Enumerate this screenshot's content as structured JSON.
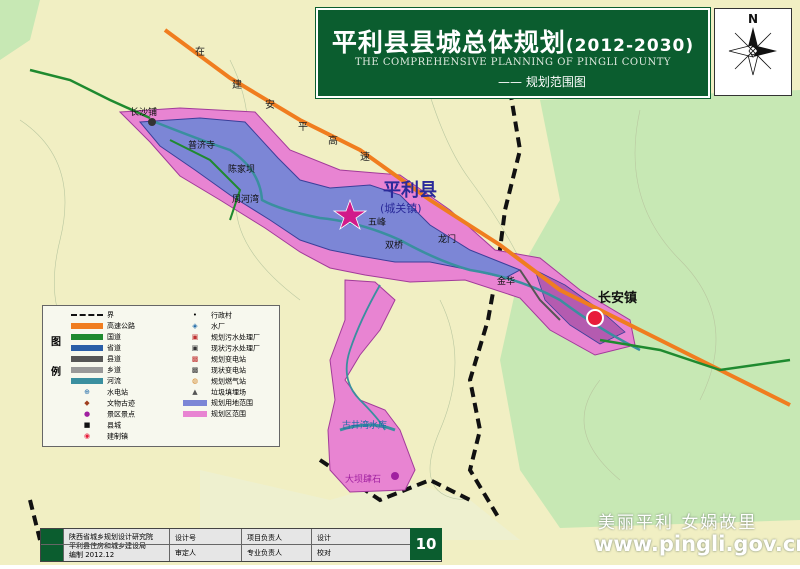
{
  "title": {
    "main": "平利县县城总体规划",
    "years": "(2012-2030)",
    "english": "THE COMPREHENSIVE PLANNING OF PINGLI COUNTY",
    "subtitle": "—— 规划范围图"
  },
  "north_label": "N",
  "map_labels": {
    "county": "平利县",
    "county_sub": "(城关镇)",
    "changan": "长安镇",
    "changsha": "长沙铺",
    "puji": "普济寺",
    "chenjiaba": "陈家坝",
    "zhouhezhen": "周河湾",
    "wufeng": "五峰",
    "shuangtiao": "双桥",
    "longmen": "龙门",
    "jinhua": "金华",
    "gujingwan": "古井湾水库",
    "dahu": "大坝肆石",
    "highway_chars": [
      "在",
      "建",
      "安",
      "平",
      "高",
      "速"
    ]
  },
  "legend": {
    "heading": "图例",
    "left": [
      "界",
      "高速公路",
      "国道",
      "省道",
      "县道",
      "乡道",
      "河流",
      "水电站",
      "文物古迹",
      "景区景点",
      "县城",
      "建制镇"
    ],
    "right": [
      "行政村",
      "水厂",
      "规划污水处理厂",
      "现状污水处理厂",
      "规划变电站",
      "现状变电站",
      "规划燃气站",
      "垃圾填埋场",
      "规划用地范围",
      "规划区范围"
    ]
  },
  "bottom": {
    "org1": "陕西省城乡规划设计研究院",
    "org2": "平利县住房和城乡建设局",
    "date": "编制 2012.12",
    "c1a": "设计号",
    "c1b": "审定人",
    "c2a": "项目负责人",
    "c2b": "专业负责人",
    "c3a": "设计",
    "c3b": "校对"
  },
  "page_number": "10",
  "watermark": {
    "line1": "美丽平利 女娲故里",
    "line2": "www.pingli.gov.cn"
  },
  "colors": {
    "terrain_yellow": "#f1efc3",
    "terrain_green": "#c7e8b4",
    "planning_zone": "#e884d2",
    "built_zone": "#7c86d6",
    "highway_orange": "#f07d1f",
    "river": "#3a8f9f",
    "title_bg": "#0b5d2f"
  }
}
